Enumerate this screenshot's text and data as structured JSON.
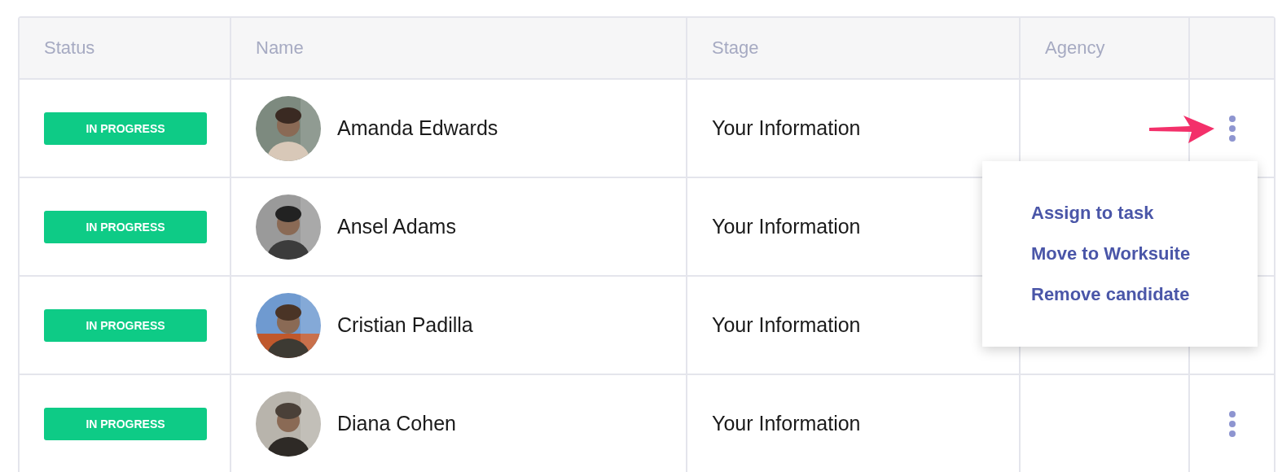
{
  "table": {
    "columns": [
      "Status",
      "Name",
      "Stage",
      "Agency"
    ],
    "rows": [
      {
        "status": "IN PROGRESS",
        "name": "Amanda Edwards",
        "stage": "Your Information",
        "menu_open": true
      },
      {
        "status": "IN PROGRESS",
        "name": "Ansel Adams",
        "stage": "Your Information",
        "menu_open": false
      },
      {
        "status": "IN PROGRESS",
        "name": "Cristian Padilla",
        "stage": "Your Information",
        "menu_open": false
      },
      {
        "status": "IN PROGRESS",
        "name": "Diana Cohen",
        "stage": "Your Information",
        "menu_open": false
      }
    ]
  },
  "menu": {
    "items": [
      "Assign to task",
      "Move to Worksuite",
      "Remove candidate"
    ]
  }
}
